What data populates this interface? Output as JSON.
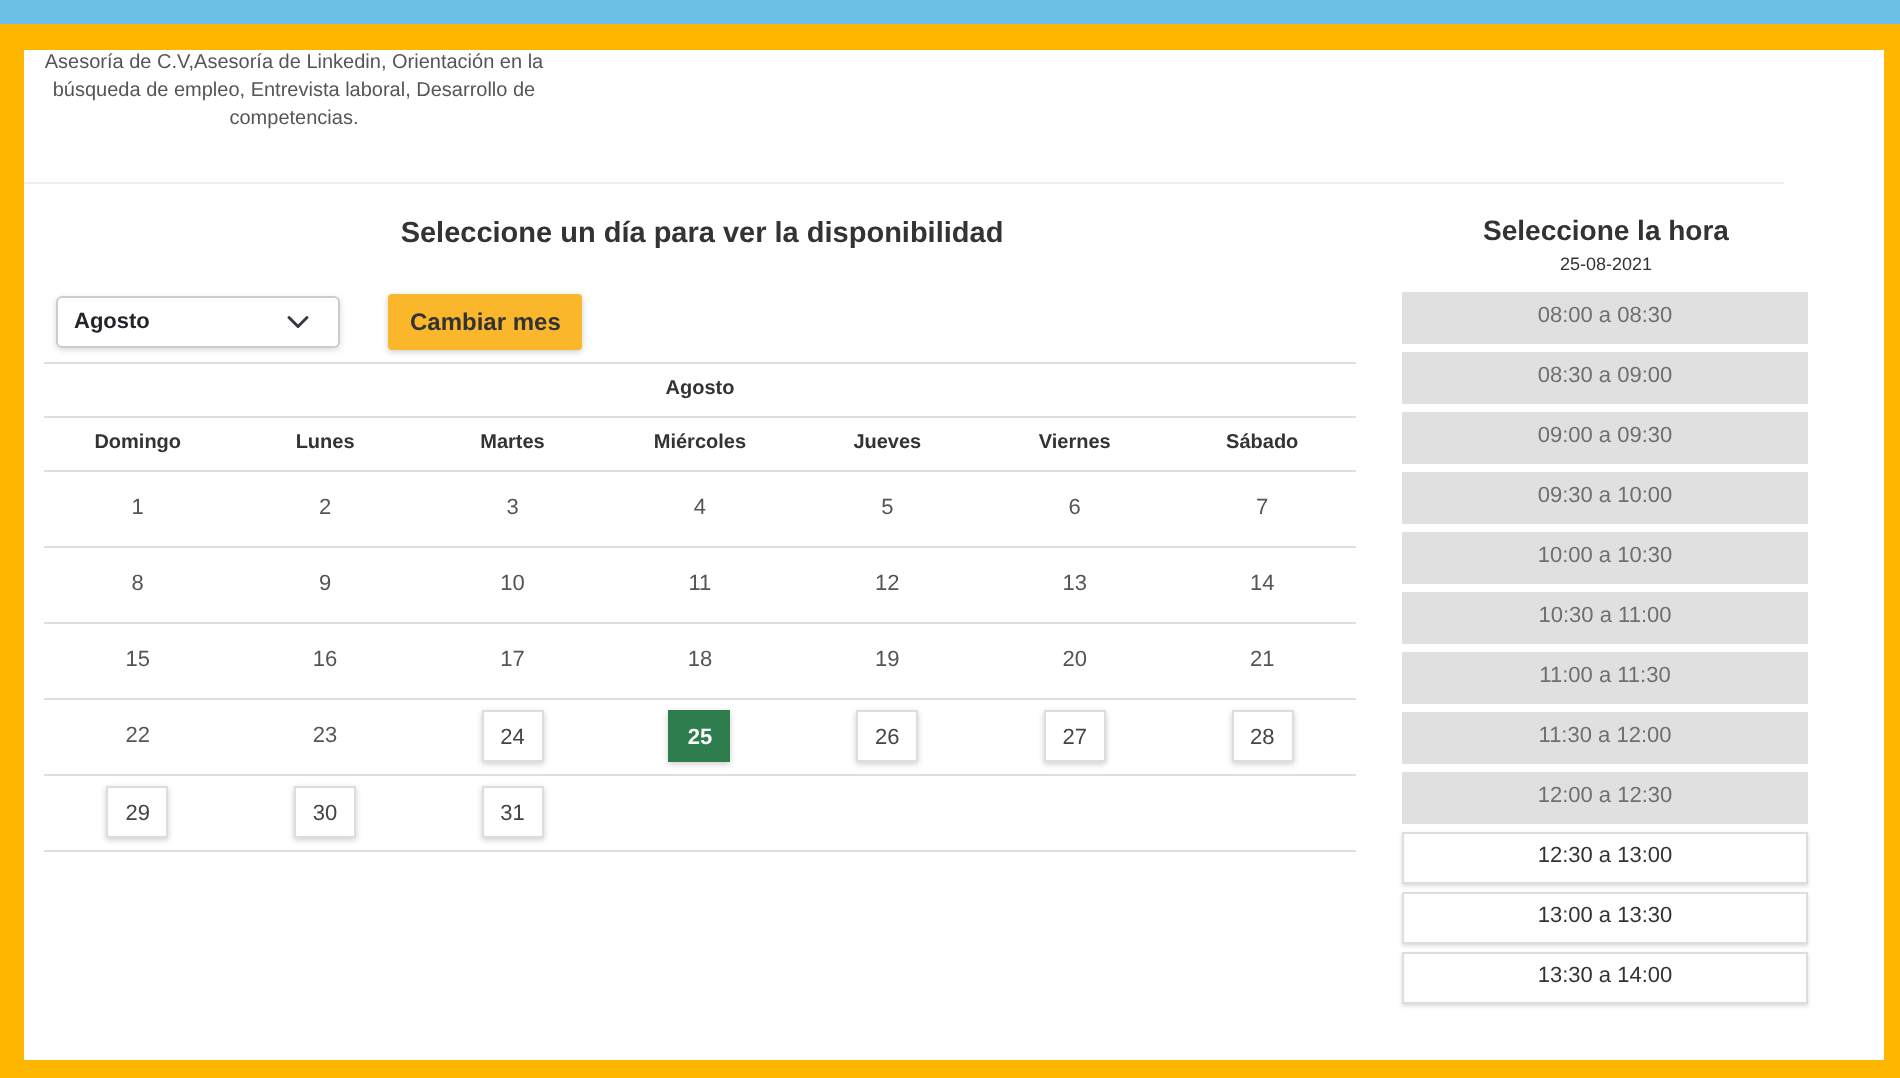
{
  "description": "Asesoría de C.V,Asesoría de Linkedin, Orientación en la búsqueda de empleo, Entrevista laboral, Desarrollo de competencias.",
  "calendar": {
    "title": "Seleccione un día para ver la disponibilidad",
    "month_select": {
      "value": "Agosto"
    },
    "change_button": "Cambiar mes",
    "month_label": "Agosto",
    "weekdays": [
      "Domingo",
      "Lunes",
      "Martes",
      "Miércoles",
      "Jueves",
      "Viernes",
      "Sábado"
    ],
    "weeks": [
      [
        {
          "day": "1",
          "available": false,
          "selected": false
        },
        {
          "day": "2",
          "available": false,
          "selected": false
        },
        {
          "day": "3",
          "available": false,
          "selected": false
        },
        {
          "day": "4",
          "available": false,
          "selected": false
        },
        {
          "day": "5",
          "available": false,
          "selected": false
        },
        {
          "day": "6",
          "available": false,
          "selected": false
        },
        {
          "day": "7",
          "available": false,
          "selected": false
        }
      ],
      [
        {
          "day": "8",
          "available": false,
          "selected": false
        },
        {
          "day": "9",
          "available": false,
          "selected": false
        },
        {
          "day": "10",
          "available": false,
          "selected": false
        },
        {
          "day": "11",
          "available": false,
          "selected": false
        },
        {
          "day": "12",
          "available": false,
          "selected": false
        },
        {
          "day": "13",
          "available": false,
          "selected": false
        },
        {
          "day": "14",
          "available": false,
          "selected": false
        }
      ],
      [
        {
          "day": "15",
          "available": false,
          "selected": false
        },
        {
          "day": "16",
          "available": false,
          "selected": false
        },
        {
          "day": "17",
          "available": false,
          "selected": false
        },
        {
          "day": "18",
          "available": false,
          "selected": false
        },
        {
          "day": "19",
          "available": false,
          "selected": false
        },
        {
          "day": "20",
          "available": false,
          "selected": false
        },
        {
          "day": "21",
          "available": false,
          "selected": false
        }
      ],
      [
        {
          "day": "22",
          "available": false,
          "selected": false
        },
        {
          "day": "23",
          "available": false,
          "selected": false
        },
        {
          "day": "24",
          "available": true,
          "selected": false
        },
        {
          "day": "25",
          "available": true,
          "selected": true
        },
        {
          "day": "26",
          "available": true,
          "selected": false
        },
        {
          "day": "27",
          "available": true,
          "selected": false
        },
        {
          "day": "28",
          "available": true,
          "selected": false
        }
      ],
      [
        {
          "day": "29",
          "available": true,
          "selected": false
        },
        {
          "day": "30",
          "available": true,
          "selected": false
        },
        {
          "day": "31",
          "available": true,
          "selected": false
        }
      ]
    ]
  },
  "hours": {
    "title": "Seleccione la hora",
    "date": "25-08-2021",
    "slots": [
      {
        "label": "08:00 a 08:30",
        "available": false
      },
      {
        "label": "08:30 a 09:00",
        "available": false
      },
      {
        "label": "09:00 a 09:30",
        "available": false
      },
      {
        "label": "09:30 a 10:00",
        "available": false
      },
      {
        "label": "10:00 a 10:30",
        "available": false
      },
      {
        "label": "10:30 a 11:00",
        "available": false
      },
      {
        "label": "11:00 a 11:30",
        "available": false
      },
      {
        "label": "11:30 a 12:00",
        "available": false
      },
      {
        "label": "12:00 a 12:30",
        "available": false
      },
      {
        "label": "12:30 a 13:00",
        "available": true
      },
      {
        "label": "13:00 a 13:30",
        "available": true
      },
      {
        "label": "13:30 a 14:00",
        "available": true
      }
    ]
  }
}
